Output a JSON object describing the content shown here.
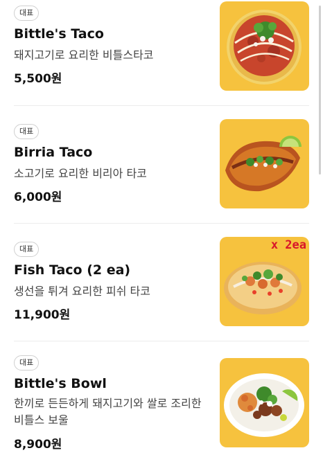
{
  "menu": {
    "items": [
      {
        "badge": "대표",
        "name": "Bittle's Taco",
        "description": "돼지고기로 요리한 비틀스타코",
        "price": "5,500원",
        "image_icon": "taco-photo"
      },
      {
        "badge": "대표",
        "name": "Birria Taco",
        "description": "소고기로 요리한 비리아 타코",
        "price": "6,000원",
        "image_icon": "birria-taco-photo"
      },
      {
        "badge": "대표",
        "name": "Fish Taco (2 ea)",
        "description": "생선을 튀겨 요리한 피쉬 타코",
        "price": "11,900원",
        "image_icon": "fish-taco-photo",
        "image_tag": "x 2ea"
      },
      {
        "badge": "대표",
        "name": "Bittle's Bowl",
        "description": "한끼로 든든하게 돼지고기와 쌀로 조리한 비틀스 보울",
        "price": "8,900원",
        "image_icon": "rice-bowl-photo"
      }
    ]
  },
  "colors": {
    "thumbnail_background": "#f6c23e",
    "badge_border": "#cfcfcf",
    "tag_red": "#d8152a"
  }
}
